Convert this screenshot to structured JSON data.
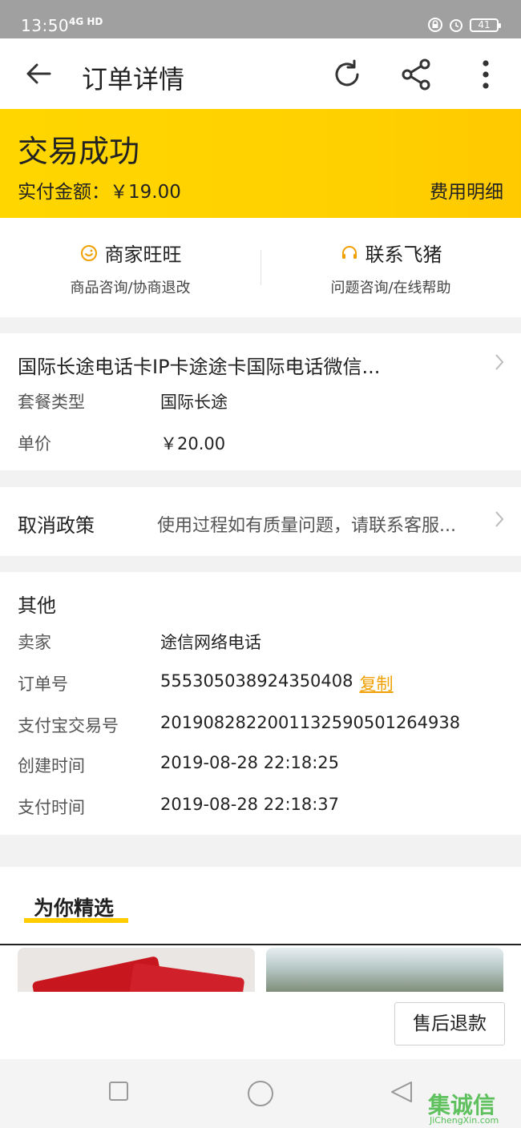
{
  "status_bar": {
    "time": "13:50",
    "network": "4G HD",
    "battery": "41"
  },
  "header": {
    "title": "订单详情"
  },
  "banner": {
    "status": "交易成功",
    "paid_label": "实付金额：",
    "paid_amount": "￥19.00",
    "fee_detail": "费用明细"
  },
  "contact": [
    {
      "title": "商家旺旺",
      "subtitle": "商品咨询/协商退改"
    },
    {
      "title": "联系飞猪",
      "subtitle": "问题咨询/在线帮助"
    }
  ],
  "product": {
    "name": "国际长途电话卡IP卡途途卡国际电话微信...",
    "rows": [
      {
        "key": "套餐类型",
        "value": "国际长途"
      },
      {
        "key": "单价",
        "value": "￥20.00"
      }
    ]
  },
  "policy": {
    "label": "取消政策",
    "value": "使用过程如有质量问题，请联系客服..."
  },
  "others": {
    "title": "其他",
    "rows": [
      {
        "key": "卖家",
        "value": "途信网络电话"
      },
      {
        "key": "订单号",
        "value": "555305038924350408",
        "action": "复制"
      },
      {
        "key": "支付宝交易号",
        "value": "2019082822001132590501264938"
      },
      {
        "key": "创建时间",
        "value": "2019-08-28 22:18:25"
      },
      {
        "key": "支付时间",
        "value": "2019-08-28 22:18:37"
      }
    ]
  },
  "recommend": {
    "title": "为你精选"
  },
  "actions": {
    "refund": "售后退款"
  },
  "watermark": {
    "cn": "集诚信",
    "en": "JiChengXin.com"
  },
  "colors": {
    "banner": "#ffd600",
    "accent": "#f0a000",
    "underline": "#ffcc00"
  }
}
